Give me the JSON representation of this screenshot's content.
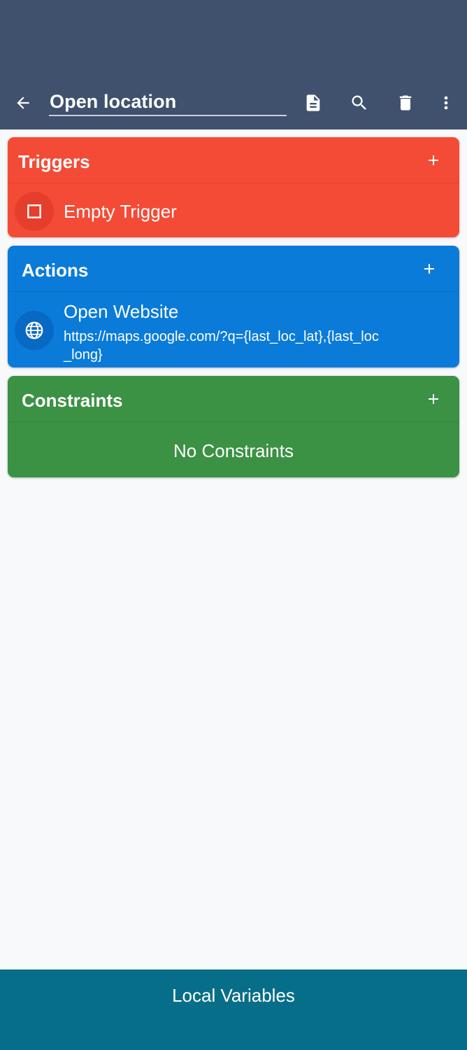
{
  "appbar": {
    "title": "Open location",
    "icons": [
      "back-arrow-icon",
      "document-icon",
      "search-icon",
      "trash-icon",
      "more-vert-icon"
    ]
  },
  "triggers": {
    "label": "Triggers",
    "items": [
      {
        "title": "Empty Trigger",
        "icon": "checkbox-outline-icon"
      }
    ]
  },
  "actions": {
    "label": "Actions",
    "items": [
      {
        "title": "Open Website",
        "subtitle_line1": "https://maps.google.com/?q={last_loc_lat},{last_loc",
        "subtitle_line2": "_long}",
        "icon": "globe-icon"
      }
    ]
  },
  "constraints": {
    "label": "Constraints",
    "empty_text": "No Constraints"
  },
  "bottom": {
    "label": "Local Variables"
  },
  "colors": {
    "appbar": "#40516e",
    "triggers": "#f44b36",
    "actions": "#0a7bd9",
    "constraints": "#3b9144",
    "bottom": "#076e89"
  }
}
